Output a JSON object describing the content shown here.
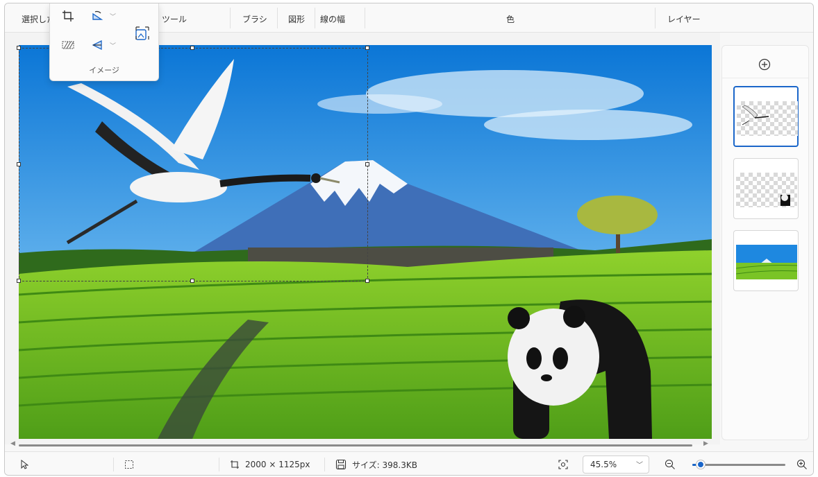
{
  "toolbar": {
    "selection_label": "選択した",
    "tools_label": "ツール",
    "brush_label": "ブラシ",
    "shapes_label": "図形",
    "line_width_label": "線の幅",
    "color_label": "色",
    "layers_label": "レイヤー"
  },
  "image_flyout": {
    "label": "イメージ",
    "icons": [
      "crop-icon",
      "rotate-icon",
      "resize-icon",
      "flip-icon",
      "mirror-icon"
    ]
  },
  "canvas": {
    "objects": [
      "mount-fuji",
      "tea-field",
      "red-crowned-crane",
      "panda",
      "tree"
    ]
  },
  "layers_panel": {
    "add_icon": "plus-circle-icon",
    "layers": [
      {
        "name": "crane-layer",
        "selected": true
      },
      {
        "name": "panda-layer",
        "selected": false
      },
      {
        "name": "background-layer",
        "selected": false
      }
    ]
  },
  "statusbar": {
    "canvas_size": "2000 × 1125px",
    "file_size": "サイズ: 398.3KB",
    "zoom_value": "45.5%",
    "zoom_level_fraction": 0.09
  },
  "colors": {
    "accent": "#1a66c9",
    "sky": "#1e88e0",
    "tea_green": "#6fc22a"
  }
}
